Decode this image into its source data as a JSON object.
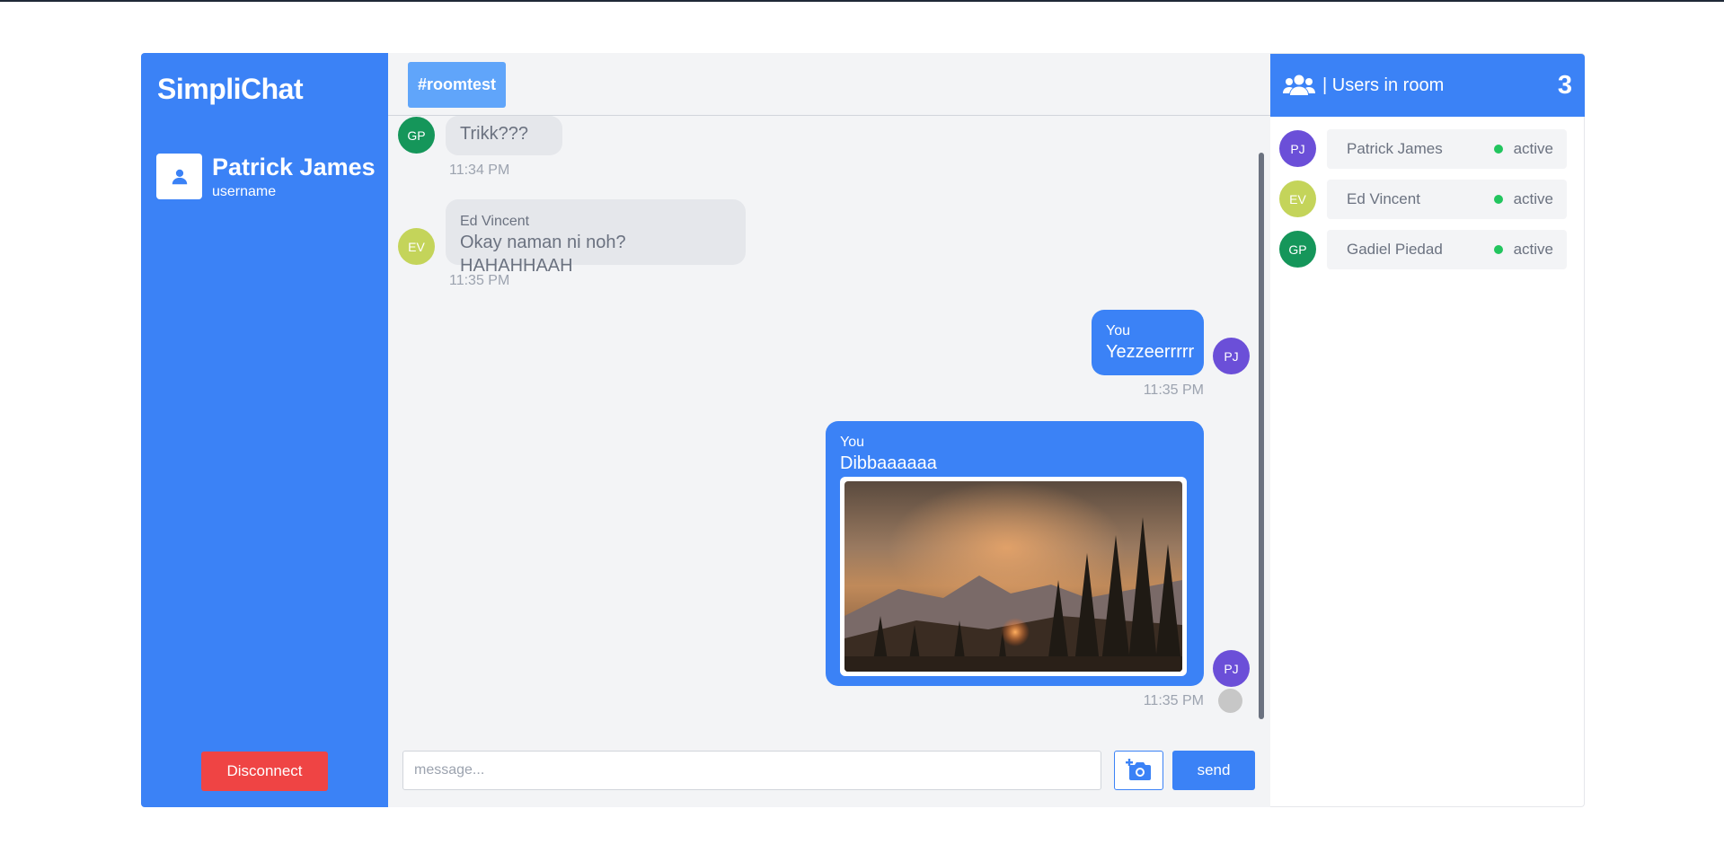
{
  "app": {
    "brand": "SimpliChat"
  },
  "profile": {
    "name": "Patrick James",
    "subtitle": "username"
  },
  "sidebar": {
    "disconnect_label": "Disconnect"
  },
  "room": {
    "tag": "#roomtest"
  },
  "messages": [
    {
      "initials": "GP",
      "avatar_color": "#15965a",
      "sender": "",
      "text": "Trikk???",
      "time": "11:34 PM",
      "mine": false
    },
    {
      "initials": "EV",
      "avatar_color": "#c4d45a",
      "sender": "Ed Vincent",
      "text": "Okay naman ni noh? HAHAHHAAH",
      "time": "11:35 PM",
      "mine": false
    },
    {
      "initials": "PJ",
      "avatar_color": "#6b4fd8",
      "sender": "You",
      "text": "Yezzeerrrrr",
      "time": "11:35 PM",
      "mine": true
    },
    {
      "initials": "PJ",
      "avatar_color": "#6b4fd8",
      "sender": "You",
      "text": "Dibbaaaaaa",
      "time": "11:35 PM",
      "mine": true,
      "image": "mountain-forest-sunset-photo"
    }
  ],
  "composer": {
    "placeholder": "message...",
    "send_label": "send",
    "camera_icon": "camera-add-icon"
  },
  "users_panel": {
    "title": "| Users in room",
    "count": "3",
    "icon": "users-icon",
    "users": [
      {
        "initials": "PJ",
        "name": "Patrick James",
        "status": "active",
        "avatar_color": "#6b4fd8"
      },
      {
        "initials": "EV",
        "name": "Ed Vincent",
        "status": "active",
        "avatar_color": "#c4d45a"
      },
      {
        "initials": "GP",
        "name": "Gadiel Piedad",
        "status": "active",
        "avatar_color": "#15965a"
      }
    ]
  },
  "colors": {
    "primary": "#3b82f6",
    "danger": "#ef4444",
    "active": "#22c55e"
  }
}
